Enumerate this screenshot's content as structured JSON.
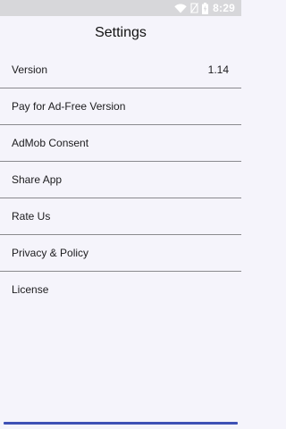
{
  "status_bar": {
    "time": "8:29",
    "icons": [
      "wifi-icon",
      "no-sim-icon",
      "battery-charging-icon"
    ]
  },
  "header": {
    "title": "Settings"
  },
  "settings": {
    "items": [
      {
        "label": "Version",
        "value": "1.14"
      },
      {
        "label": "Pay for Ad-Free Version"
      },
      {
        "label": "AdMob Consent"
      },
      {
        "label": "Share App"
      },
      {
        "label": "Rate Us"
      },
      {
        "label": "Privacy & Policy"
      },
      {
        "label": "License"
      }
    ]
  },
  "colors": {
    "background": "#f5f4fb",
    "status_bar": "#d7d7da",
    "divider": "#8a8a8e",
    "accent": "#3f51b5"
  }
}
